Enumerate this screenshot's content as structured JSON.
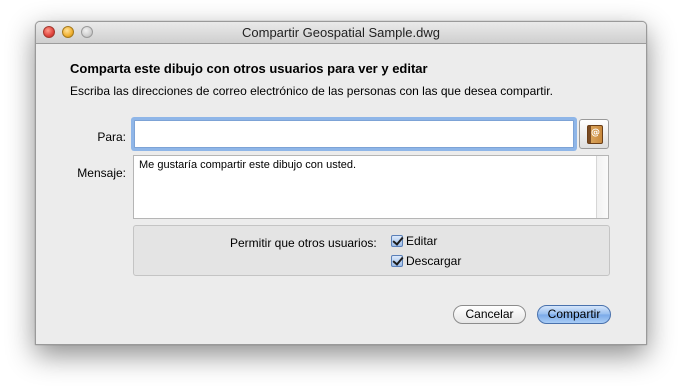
{
  "window": {
    "title": "Compartir Geospatial Sample.dwg"
  },
  "heading": "Comparta este dibujo con otros usuarios para ver y editar",
  "instructions": "Escriba las direcciones de correo electrónico de las personas con las que desea compartir.",
  "to_field": {
    "label": "Para:",
    "value": "",
    "placeholder": ""
  },
  "address_book_icon": "address-book-icon",
  "message_field": {
    "label": "Mensaje:",
    "value": "Me gustaría compartir este dibujo con usted."
  },
  "permissions": {
    "label": "Permitir que otros usuarios:",
    "options": [
      {
        "label": "Editar",
        "checked": true
      },
      {
        "label": "Descargar",
        "checked": true
      }
    ]
  },
  "buttons": {
    "cancel": "Cancelar",
    "share": "Compartir"
  },
  "colors": {
    "focus_ring": "#8fb6e8",
    "default_button": "#7aa9e8"
  }
}
